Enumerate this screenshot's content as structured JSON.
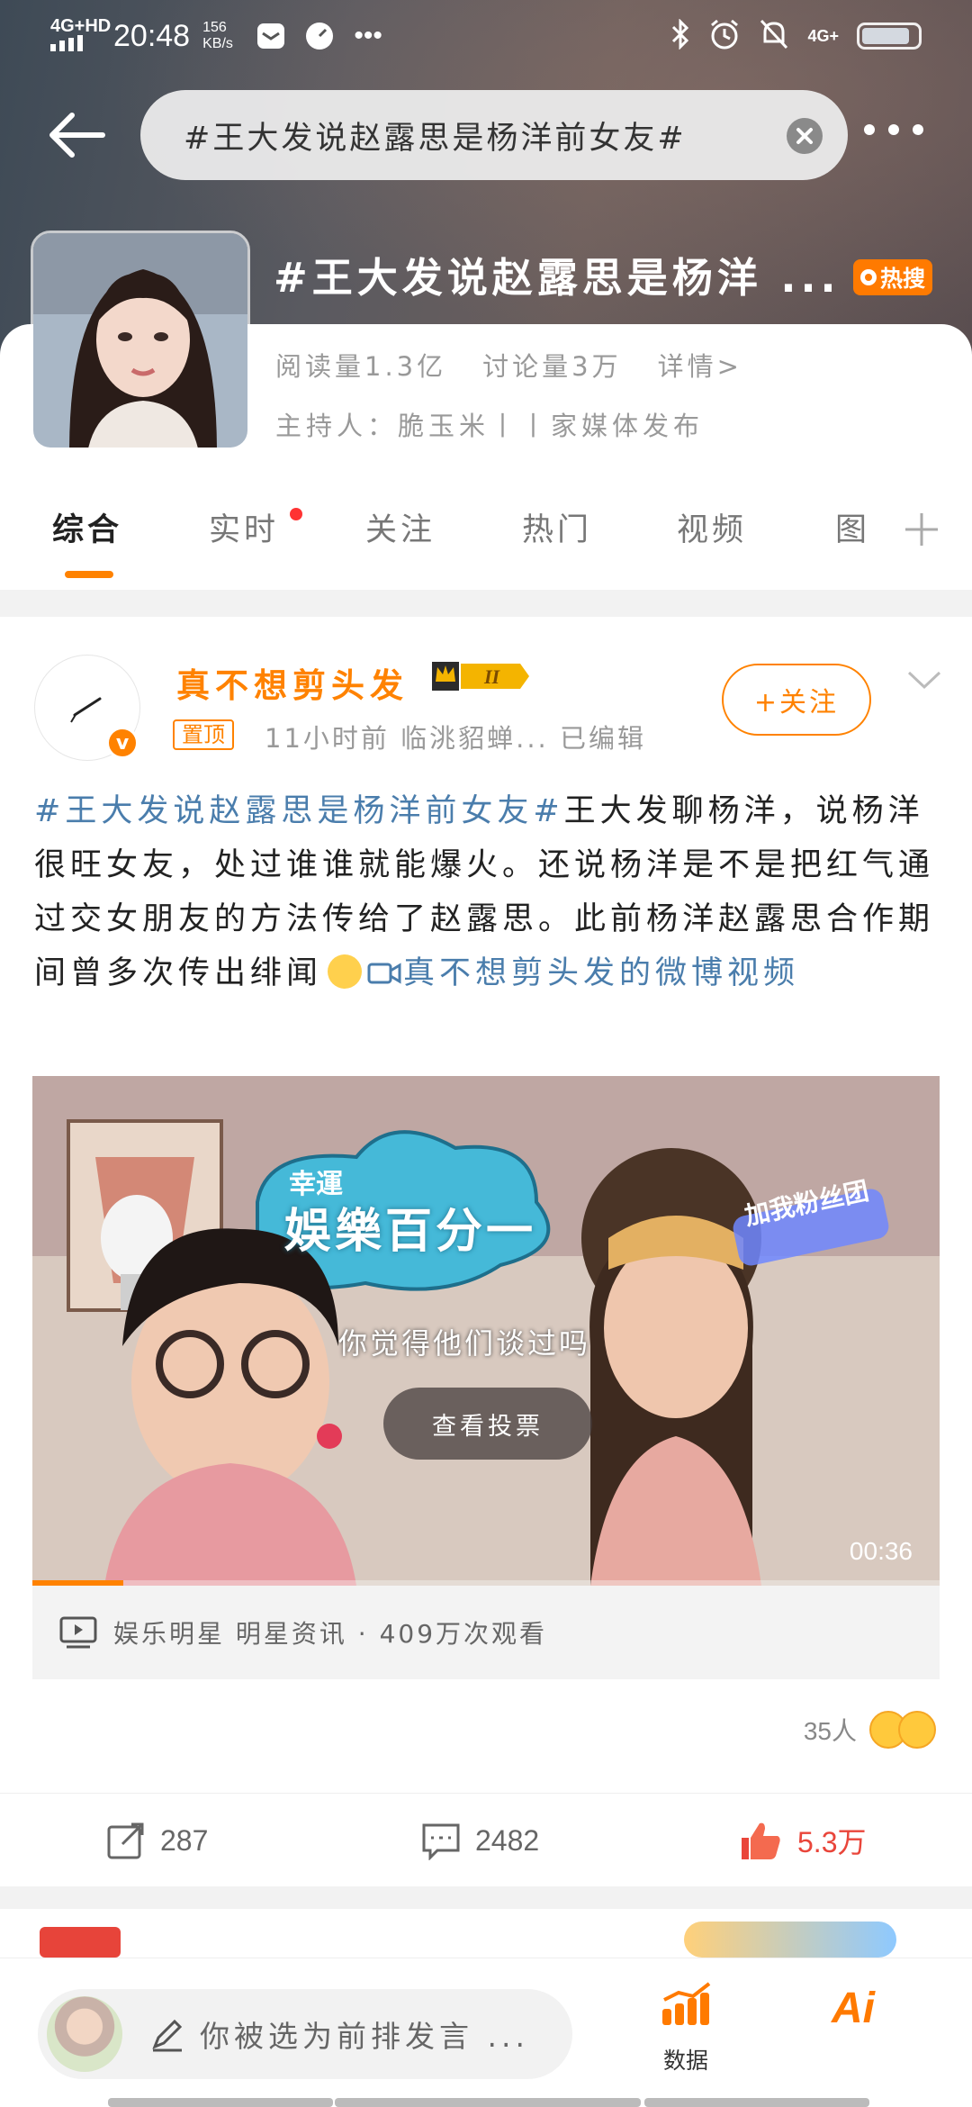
{
  "status_bar": {
    "network": "4G+HD",
    "time": "20:48",
    "speed_value": "156",
    "speed_unit": "KB/s",
    "right_network": "4G+"
  },
  "search": {
    "query": "#王大发说赵露思是杨洋前女友#"
  },
  "topic": {
    "title": "#王大发说赵露思是杨洋 ...",
    "hot_badge": "热搜",
    "reads": "阅读量1.3亿",
    "discussions": "讨论量3万",
    "details": "详情>",
    "host": "主持人：脆玉米丨丨家媒体发布"
  },
  "tabs": [
    {
      "label": "综合"
    },
    {
      "label": "实时"
    },
    {
      "label": "关注"
    },
    {
      "label": "热门"
    },
    {
      "label": "视频"
    },
    {
      "label": "图"
    }
  ],
  "post": {
    "author": "真不想剪头发",
    "vip_level": "II",
    "pinned": "置顶",
    "meta": "11小时前  临洮貂蝉...  已编辑",
    "follow": "+关注",
    "topic_link": "#王大发说赵露思是杨洋前女友#",
    "body": "王大发聊杨洋，说杨洋很旺女友，处过谁谁就能爆火。还说杨洋是不是把红气通过交女朋友的方法传给了赵露思。此前杨洋赵露思合作期间曾多次传出绯闻",
    "video_link": "真不想剪头发的微博视频",
    "video": {
      "subtitle": "你觉得他们谈过吗",
      "vote_button": "查看投票",
      "duration": "00:36",
      "show_logo_top": "幸運",
      "show_logo_main": "娛樂百分一",
      "sticker": "加我粉丝团",
      "progress": 0.1
    },
    "video_info": "娱乐明星  明星资讯 · 409万次观看",
    "reactions_count": "35人",
    "reposts": "287",
    "comments": "2482",
    "likes": "5.3万"
  },
  "bottom_bar": {
    "comment_placeholder": "你被选为前排发言 ...",
    "data_label": "数据",
    "ai_label": "Ai"
  },
  "colors": {
    "accent": "#ff8200",
    "link": "#4a7dac",
    "like": "#e9453a"
  }
}
